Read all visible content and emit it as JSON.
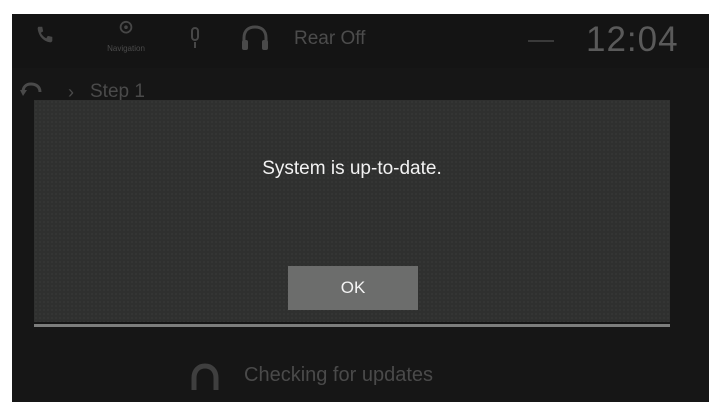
{
  "status_bar": {
    "phone_icon": "phone-icon",
    "nav_label": "Navigation",
    "mic_icon": "microphone-icon",
    "headphones_icon": "headphones-icon",
    "rear_audio_label": "Rear Off",
    "signal_icon": "connectivity-icon",
    "time": "12:04"
  },
  "breadcrumb": {
    "back_icon": "back-icon",
    "separator": "›",
    "label": "Step 1"
  },
  "dialog": {
    "message": "System is up-to-date.",
    "ok_label": "OK"
  },
  "background_status": {
    "spinner_icon": "spinner-icon",
    "text": "Checking for updates"
  },
  "colors": {
    "screen_bg": "#161616",
    "dialog_bg": "#2f302f",
    "button_bg": "#6c6d6c",
    "dim_text": "#4a4a4a"
  }
}
